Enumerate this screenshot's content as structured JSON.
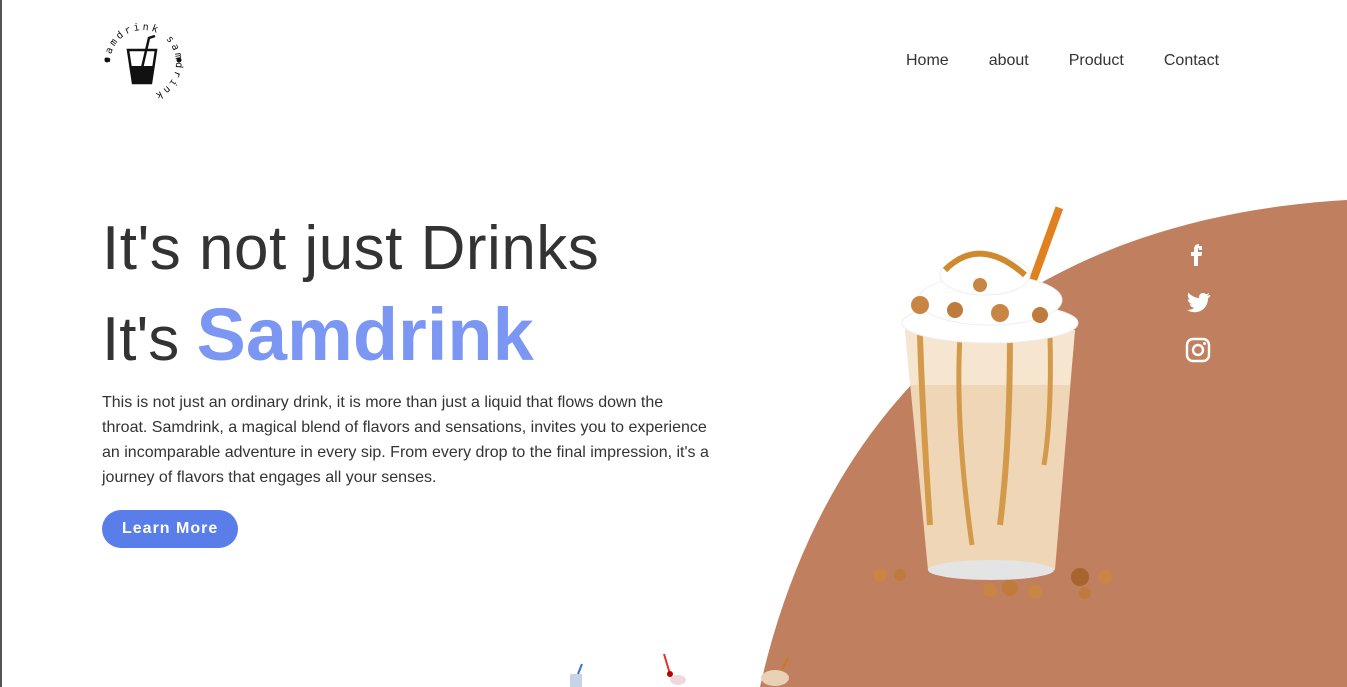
{
  "logo": {
    "ring_text": "samdrink samdrink"
  },
  "nav": {
    "items": [
      "Home",
      "about",
      "Product",
      "Contact"
    ]
  },
  "hero": {
    "line1": "It's not just Drinks",
    "line2_prefix": "It's",
    "brand": "Samdrink",
    "description": "This is not just an ordinary drink, it is more than just a liquid that flows down the throat. Samdrink, a magical blend of flavors and sensations, invites you to experience an incomparable adventure in every sip. From every drop to the final impression, it's a journey of flavors that engages all your senses.",
    "button": "Learn More"
  },
  "social": {
    "icons": [
      "facebook-icon",
      "twitter-icon",
      "instagram-icon"
    ]
  },
  "colors": {
    "accent": "#7b97f3",
    "button": "#5a7ee9",
    "arc": "#c07f5f"
  }
}
